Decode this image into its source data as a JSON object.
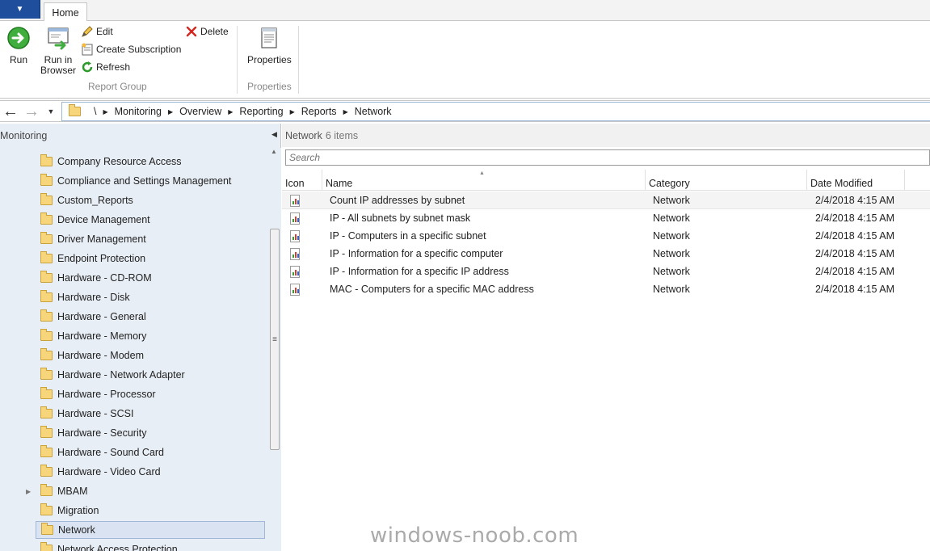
{
  "ribbon": {
    "tab_home": "Home",
    "app_menu_glyph": "▼",
    "run": "Run",
    "run_in_browser_line1": "Run in",
    "run_in_browser_line2": "Browser",
    "edit": "Edit",
    "create_subscription": "Create Subscription",
    "refresh": "Refresh",
    "delete": "Delete",
    "group_report": "Report Group",
    "properties": "Properties",
    "group_properties": "Properties"
  },
  "address": {
    "root": "\\",
    "crumbs": [
      "Monitoring",
      "Overview",
      "Reporting",
      "Reports",
      "Network"
    ]
  },
  "nav": {
    "title": "Monitoring",
    "items": [
      "Company Resource Access",
      "Compliance and Settings Management",
      "Custom_Reports",
      "Device Management",
      "Driver Management",
      "Endpoint Protection",
      "Hardware - CD-ROM",
      "Hardware - Disk",
      "Hardware - General",
      "Hardware - Memory",
      "Hardware - Modem",
      "Hardware - Network Adapter",
      "Hardware - Processor",
      "Hardware - SCSI",
      "Hardware - Security",
      "Hardware - Sound Card",
      "Hardware - Video Card",
      "MBAM",
      "Migration",
      "Network",
      "Network Access Protection"
    ],
    "selected": "Network"
  },
  "content": {
    "title": "Network",
    "count": "6 items",
    "search_placeholder": "Search",
    "columns": [
      "Icon",
      "Name",
      "Category",
      "Date Modified"
    ],
    "rows": [
      {
        "name": "Count IP addresses by subnet",
        "category": "Network",
        "date": "2/4/2018 4:15 AM"
      },
      {
        "name": "IP - All subnets by subnet mask",
        "category": "Network",
        "date": "2/4/2018 4:15 AM"
      },
      {
        "name": "IP - Computers in a specific subnet",
        "category": "Network",
        "date": "2/4/2018 4:15 AM"
      },
      {
        "name": "IP - Information for a specific computer",
        "category": "Network",
        "date": "2/4/2018 4:15 AM"
      },
      {
        "name": "IP - Information for a specific IP address",
        "category": "Network",
        "date": "2/4/2018 4:15 AM"
      },
      {
        "name": "MAC - Computers for a specific MAC address",
        "category": "Network",
        "date": "2/4/2018 4:15 AM"
      }
    ]
  },
  "watermark": "windows-noob.com",
  "colors": {
    "app_menu": "#1f4e9c",
    "nav_background": "#e8eef6",
    "selection": "#d9e3f1"
  }
}
